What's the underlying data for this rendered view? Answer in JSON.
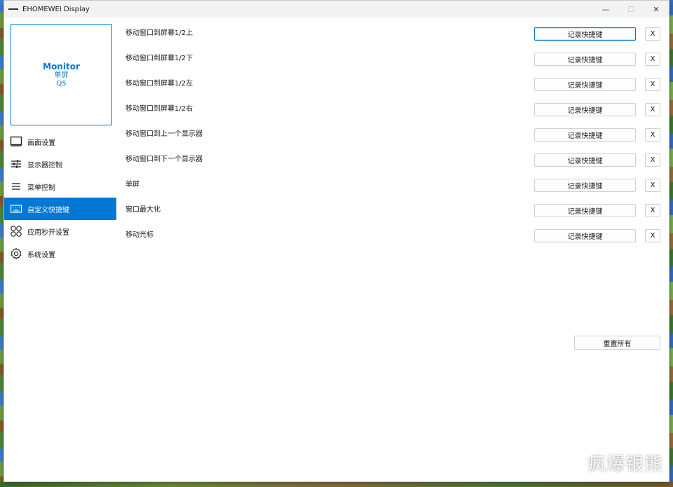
{
  "window": {
    "title": "EHOMEWEI Display",
    "minimize_glyph": "—",
    "maximize_glyph": "☐",
    "close_glyph": "✕"
  },
  "monitor": {
    "name": "Monitor",
    "mode": "单屏",
    "model": "Q5"
  },
  "sidebar": {
    "active_index": 3,
    "items": [
      {
        "label": "画面设置",
        "icon": "display-icon"
      },
      {
        "label": "显示器控制",
        "icon": "sliders-icon"
      },
      {
        "label": "菜单控制",
        "icon": "menu-icon"
      },
      {
        "label": "自定义快捷键",
        "icon": "keyboard-icon"
      },
      {
        "label": "应用秒开设置",
        "icon": "apps-grid-icon"
      },
      {
        "label": "系统设置",
        "icon": "gear-icon"
      }
    ]
  },
  "shortcuts": {
    "record_label": "记录快捷键",
    "clear_label": "X",
    "rows": [
      {
        "label": "移动窗口到屏幕1/2上"
      },
      {
        "label": "移动窗口到屏幕1/2下"
      },
      {
        "label": "移动窗口到屏幕1/2左"
      },
      {
        "label": "移动窗口到屏幕1/2右"
      },
      {
        "label": "移动窗口到上一个显示器"
      },
      {
        "label": "移动窗口到下一个显示器"
      },
      {
        "label": "单屏"
      },
      {
        "label": "窗口最大化"
      },
      {
        "label": "移动光标"
      }
    ],
    "reset_all_label": "重置所有"
  },
  "watermark": "疯爆银熊",
  "colors": {
    "accent": "#0078d4",
    "window_bg": "#ffffff",
    "titlebar_bg": "#f3f3f3"
  }
}
